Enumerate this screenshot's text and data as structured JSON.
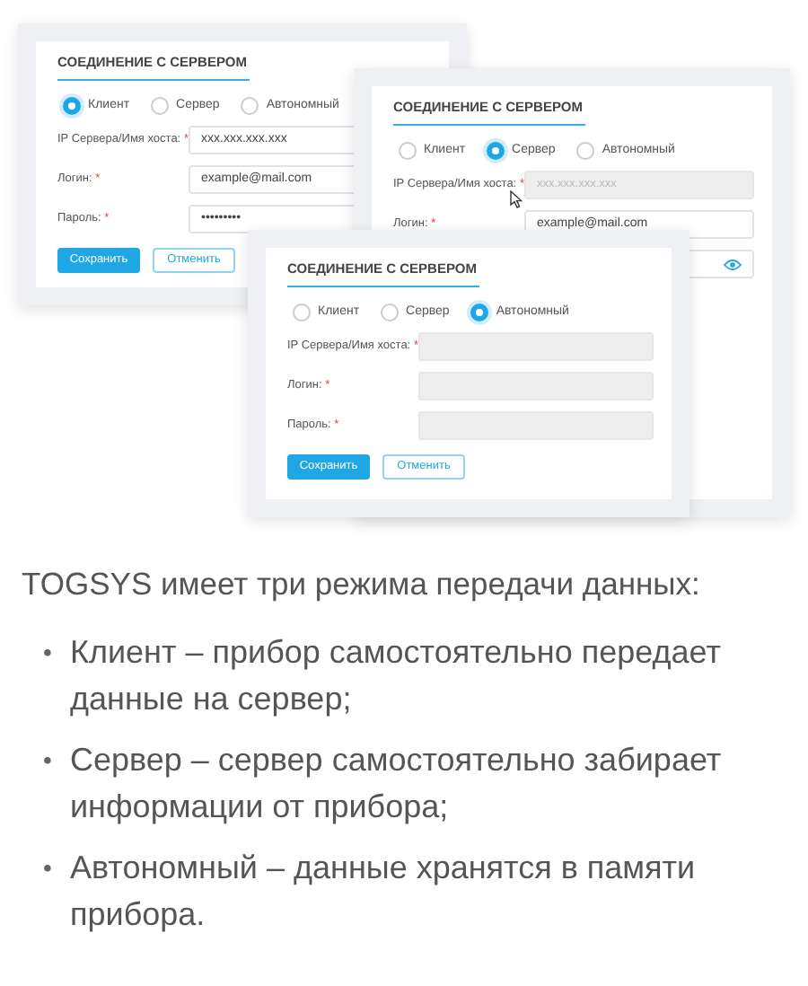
{
  "cards": [
    {
      "title": "СОЕДИНЕНИЕ С СЕРВЕРОМ",
      "modes": [
        {
          "label": "Клиент",
          "selected": true
        },
        {
          "label": "Сервер",
          "selected": false
        },
        {
          "label": "Автономный",
          "selected": false
        }
      ],
      "fields": [
        {
          "label": "IP Сервера/Имя хоста:",
          "mark": "*",
          "value": "xxx.xxx.xxx.xxx",
          "disabled": false
        },
        {
          "label": "Логин:",
          "mark": "*",
          "value": "example@mail.com",
          "disabled": false
        },
        {
          "label": "Пароль:",
          "mark": "*",
          "value": "•••••••••",
          "disabled": false
        }
      ],
      "buttons": [
        {
          "label": "Сохранить",
          "kind": "primary"
        },
        {
          "label": "Отменить",
          "kind": "secondary"
        }
      ]
    },
    {
      "title": "СОЕДИНЕНИЕ С СЕРВЕРОМ",
      "modes": [
        {
          "label": "Клиент",
          "selected": false
        },
        {
          "label": "Сервер",
          "selected": true
        },
        {
          "label": "Автономный",
          "selected": false
        }
      ],
      "fields": [
        {
          "label": "IP Сервера/Имя хоста:",
          "mark": "*",
          "placeholder": "xxx.xxx.xxx.xxx",
          "disabled": true
        },
        {
          "label": "Логин:",
          "mark": "*",
          "value": "example@mail.com",
          "disabled": false
        },
        {
          "disabled": false,
          "show_toggle": true
        }
      ],
      "pointer": true
    },
    {
      "title": "СОЕДИНЕНИЕ С СЕРВЕРОМ",
      "modes": [
        {
          "label": "Клиент",
          "selected": false
        },
        {
          "label": "Сервер",
          "selected": false
        },
        {
          "label": "Автономный",
          "selected": true
        }
      ],
      "fields": [
        {
          "label": "IP Сервера/Имя хоста:",
          "mark": "*",
          "disabled": true
        },
        {
          "label": "Логин:",
          "mark": "*",
          "disabled": true
        },
        {
          "label": "Пароль:",
          "mark": "*",
          "disabled": true
        }
      ],
      "buttons": [
        {
          "label": "Сохранить",
          "kind": "primary"
        },
        {
          "label": "Отменить",
          "kind": "secondary"
        }
      ]
    }
  ],
  "intro": "TOGSYS имеет три режима передачи данных:",
  "modes_list": [
    {
      "marker": "•",
      "text": "Клиент – прибор самостоятельно передает данные на сервер;"
    },
    {
      "marker": "•",
      "text": "Сервер – сервер самостоятельно забирает информации от прибора;"
    },
    {
      "marker": "•",
      "text": "Автономный – данные хранятся в памяти прибора."
    }
  ]
}
